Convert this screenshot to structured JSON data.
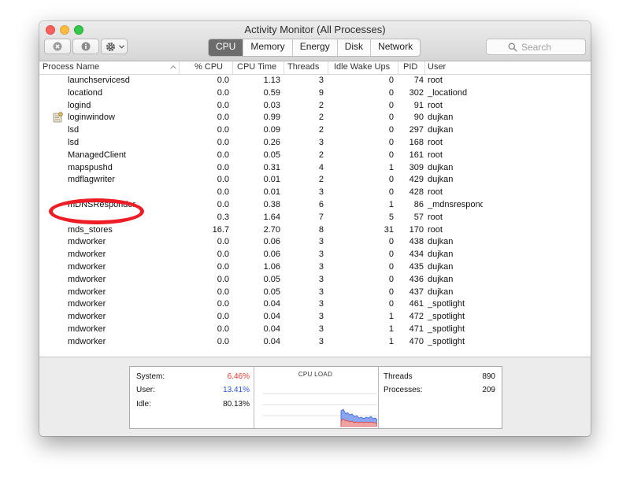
{
  "window": {
    "title": "Activity Monitor (All Processes)",
    "traffic_lights": {
      "close": "#fc605c",
      "minimize": "#fdbc40",
      "zoom": "#34c84a"
    }
  },
  "toolbar": {
    "buttons": [
      {
        "name": "stop-process",
        "icon": "x-circle-icon"
      },
      {
        "name": "inspect-process",
        "icon": "info-icon"
      },
      {
        "name": "action-menu",
        "icon": "gear-icon"
      }
    ],
    "tabs": [
      "CPU",
      "Memory",
      "Energy",
      "Disk",
      "Network"
    ],
    "active_tab": "CPU",
    "search": {
      "placeholder": "Search"
    }
  },
  "table": {
    "columns": [
      "Process Name",
      "% CPU",
      "CPU Time",
      "Threads",
      "Idle Wake Ups",
      "PID",
      "User"
    ],
    "sort_column": "Process Name",
    "rows": [
      {
        "name": "launchservicesd",
        "cpu": "0.0",
        "time": "1.13",
        "threads": "3",
        "wake": "0",
        "pid": "74",
        "user": "root"
      },
      {
        "name": "locationd",
        "cpu": "0.0",
        "time": "0.59",
        "threads": "9",
        "wake": "0",
        "pid": "302",
        "user": "_locationd"
      },
      {
        "name": "logind",
        "cpu": "0.0",
        "time": "0.03",
        "threads": "2",
        "wake": "0",
        "pid": "91",
        "user": "root"
      },
      {
        "name": "loginwindow",
        "cpu": "0.0",
        "time": "0.99",
        "threads": "2",
        "wake": "0",
        "pid": "90",
        "user": "dujkan",
        "icon": "loginwindow-icon"
      },
      {
        "name": "lsd",
        "cpu": "0.0",
        "time": "0.09",
        "threads": "2",
        "wake": "0",
        "pid": "297",
        "user": "dujkan"
      },
      {
        "name": "lsd",
        "cpu": "0.0",
        "time": "0.26",
        "threads": "3",
        "wake": "0",
        "pid": "168",
        "user": "root"
      },
      {
        "name": "ManagedClient",
        "cpu": "0.0",
        "time": "0.05",
        "threads": "2",
        "wake": "0",
        "pid": "161",
        "user": "root"
      },
      {
        "name": "mapspushd",
        "cpu": "0.0",
        "time": "0.31",
        "threads": "4",
        "wake": "1",
        "pid": "309",
        "user": "dujkan"
      },
      {
        "name": "mdflagwriter",
        "cpu": "0.0",
        "time": "0.01",
        "threads": "2",
        "wake": "0",
        "pid": "429",
        "user": "dujkan"
      },
      {
        "name": "",
        "cpu": "0.0",
        "time": "0.01",
        "threads": "3",
        "wake": "0",
        "pid": "428",
        "user": "root"
      },
      {
        "name": "mDNSResponder",
        "cpu": "0.0",
        "time": "0.38",
        "threads": "6",
        "wake": "1",
        "pid": "86",
        "user": "_mdnsrespond"
      },
      {
        "name": "",
        "cpu": "0.3",
        "time": "1.64",
        "threads": "7",
        "wake": "5",
        "pid": "57",
        "user": "root"
      },
      {
        "name": "mds_stores",
        "cpu": "16.7",
        "time": "2.70",
        "threads": "8",
        "wake": "31",
        "pid": "170",
        "user": "root"
      },
      {
        "name": "mdworker",
        "cpu": "0.0",
        "time": "0.06",
        "threads": "3",
        "wake": "0",
        "pid": "438",
        "user": "dujkan"
      },
      {
        "name": "mdworker",
        "cpu": "0.0",
        "time": "0.06",
        "threads": "3",
        "wake": "0",
        "pid": "434",
        "user": "dujkan"
      },
      {
        "name": "mdworker",
        "cpu": "0.0",
        "time": "1.06",
        "threads": "3",
        "wake": "0",
        "pid": "435",
        "user": "dujkan"
      },
      {
        "name": "mdworker",
        "cpu": "0.0",
        "time": "0.05",
        "threads": "3",
        "wake": "0",
        "pid": "436",
        "user": "dujkan"
      },
      {
        "name": "mdworker",
        "cpu": "0.0",
        "time": "0.05",
        "threads": "3",
        "wake": "0",
        "pid": "437",
        "user": "dujkan"
      },
      {
        "name": "mdworker",
        "cpu": "0.0",
        "time": "0.04",
        "threads": "3",
        "wake": "0",
        "pid": "461",
        "user": "_spotlight"
      },
      {
        "name": "mdworker",
        "cpu": "0.0",
        "time": "0.04",
        "threads": "3",
        "wake": "1",
        "pid": "472",
        "user": "_spotlight"
      },
      {
        "name": "mdworker",
        "cpu": "0.0",
        "time": "0.04",
        "threads": "3",
        "wake": "1",
        "pid": "471",
        "user": "_spotlight"
      },
      {
        "name": "mdworker",
        "cpu": "0.0",
        "time": "0.04",
        "threads": "3",
        "wake": "1",
        "pid": "470",
        "user": "_spotlight"
      }
    ]
  },
  "annotation": {
    "color": "#ee1c24",
    "target": "mDNSResponder"
  },
  "summary": {
    "system_label": "System:",
    "system_value": "6.46%",
    "system_color": "#e8392e",
    "user_label": "User:",
    "user_value": "13.41%",
    "user_color": "#2c56d8",
    "idle_label": "Idle:",
    "idle_value": "80.13%",
    "cpu_load_title": "CPU LOAD",
    "threads_label": "Threads",
    "threads_value": "890",
    "processes_label": "Processes:",
    "processes_value": "209"
  }
}
